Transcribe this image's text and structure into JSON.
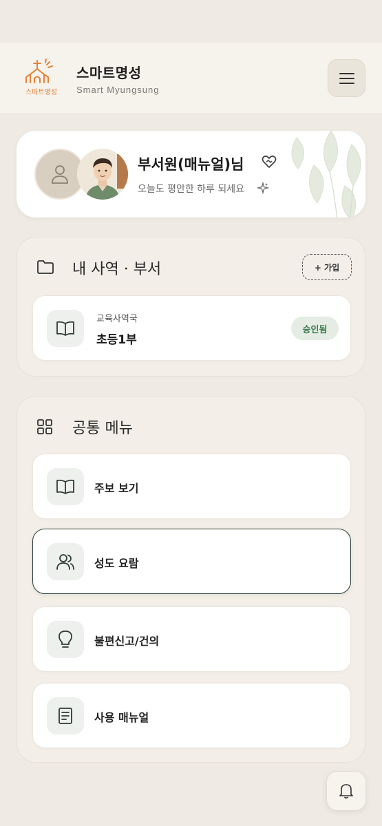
{
  "header": {
    "logo_text": "스마트명성",
    "title": "스마트명성",
    "subtitle": "Smart Myungsung",
    "menu_icon": "hamburger-menu-icon"
  },
  "profile": {
    "name": "부서원(매뉴얼)님",
    "greeting": "오늘도 평안한 하루 되세요",
    "default_avatar_icon": "user-icon",
    "name_icon": "heart-handshake-icon",
    "greeting_icon": "sparkle-icon"
  },
  "ministry": {
    "title": "내 사역 · 부서",
    "icon": "folder-icon",
    "join_label": "+ 가입",
    "items": [
      {
        "category": "교육사역국",
        "name": "초등1부",
        "status": "승인됨",
        "icon": "book-icon"
      }
    ]
  },
  "common_menu": {
    "title": "공통 메뉴",
    "icon": "grid-icon",
    "items": [
      {
        "label": "주보 보기",
        "icon": "book-open-icon"
      },
      {
        "label": "성도 요람",
        "icon": "users-icon"
      },
      {
        "label": "불편신고/건의",
        "icon": "lightbulb-icon"
      },
      {
        "label": "사용 매뉴얼",
        "icon": "document-icon"
      }
    ]
  },
  "notifications": {
    "icon": "bell-icon"
  },
  "colors": {
    "background": "#efebe4",
    "accent_orange": "#e5813a",
    "approved_green": "#3f7a52",
    "selected_border": "#2d3f37"
  }
}
